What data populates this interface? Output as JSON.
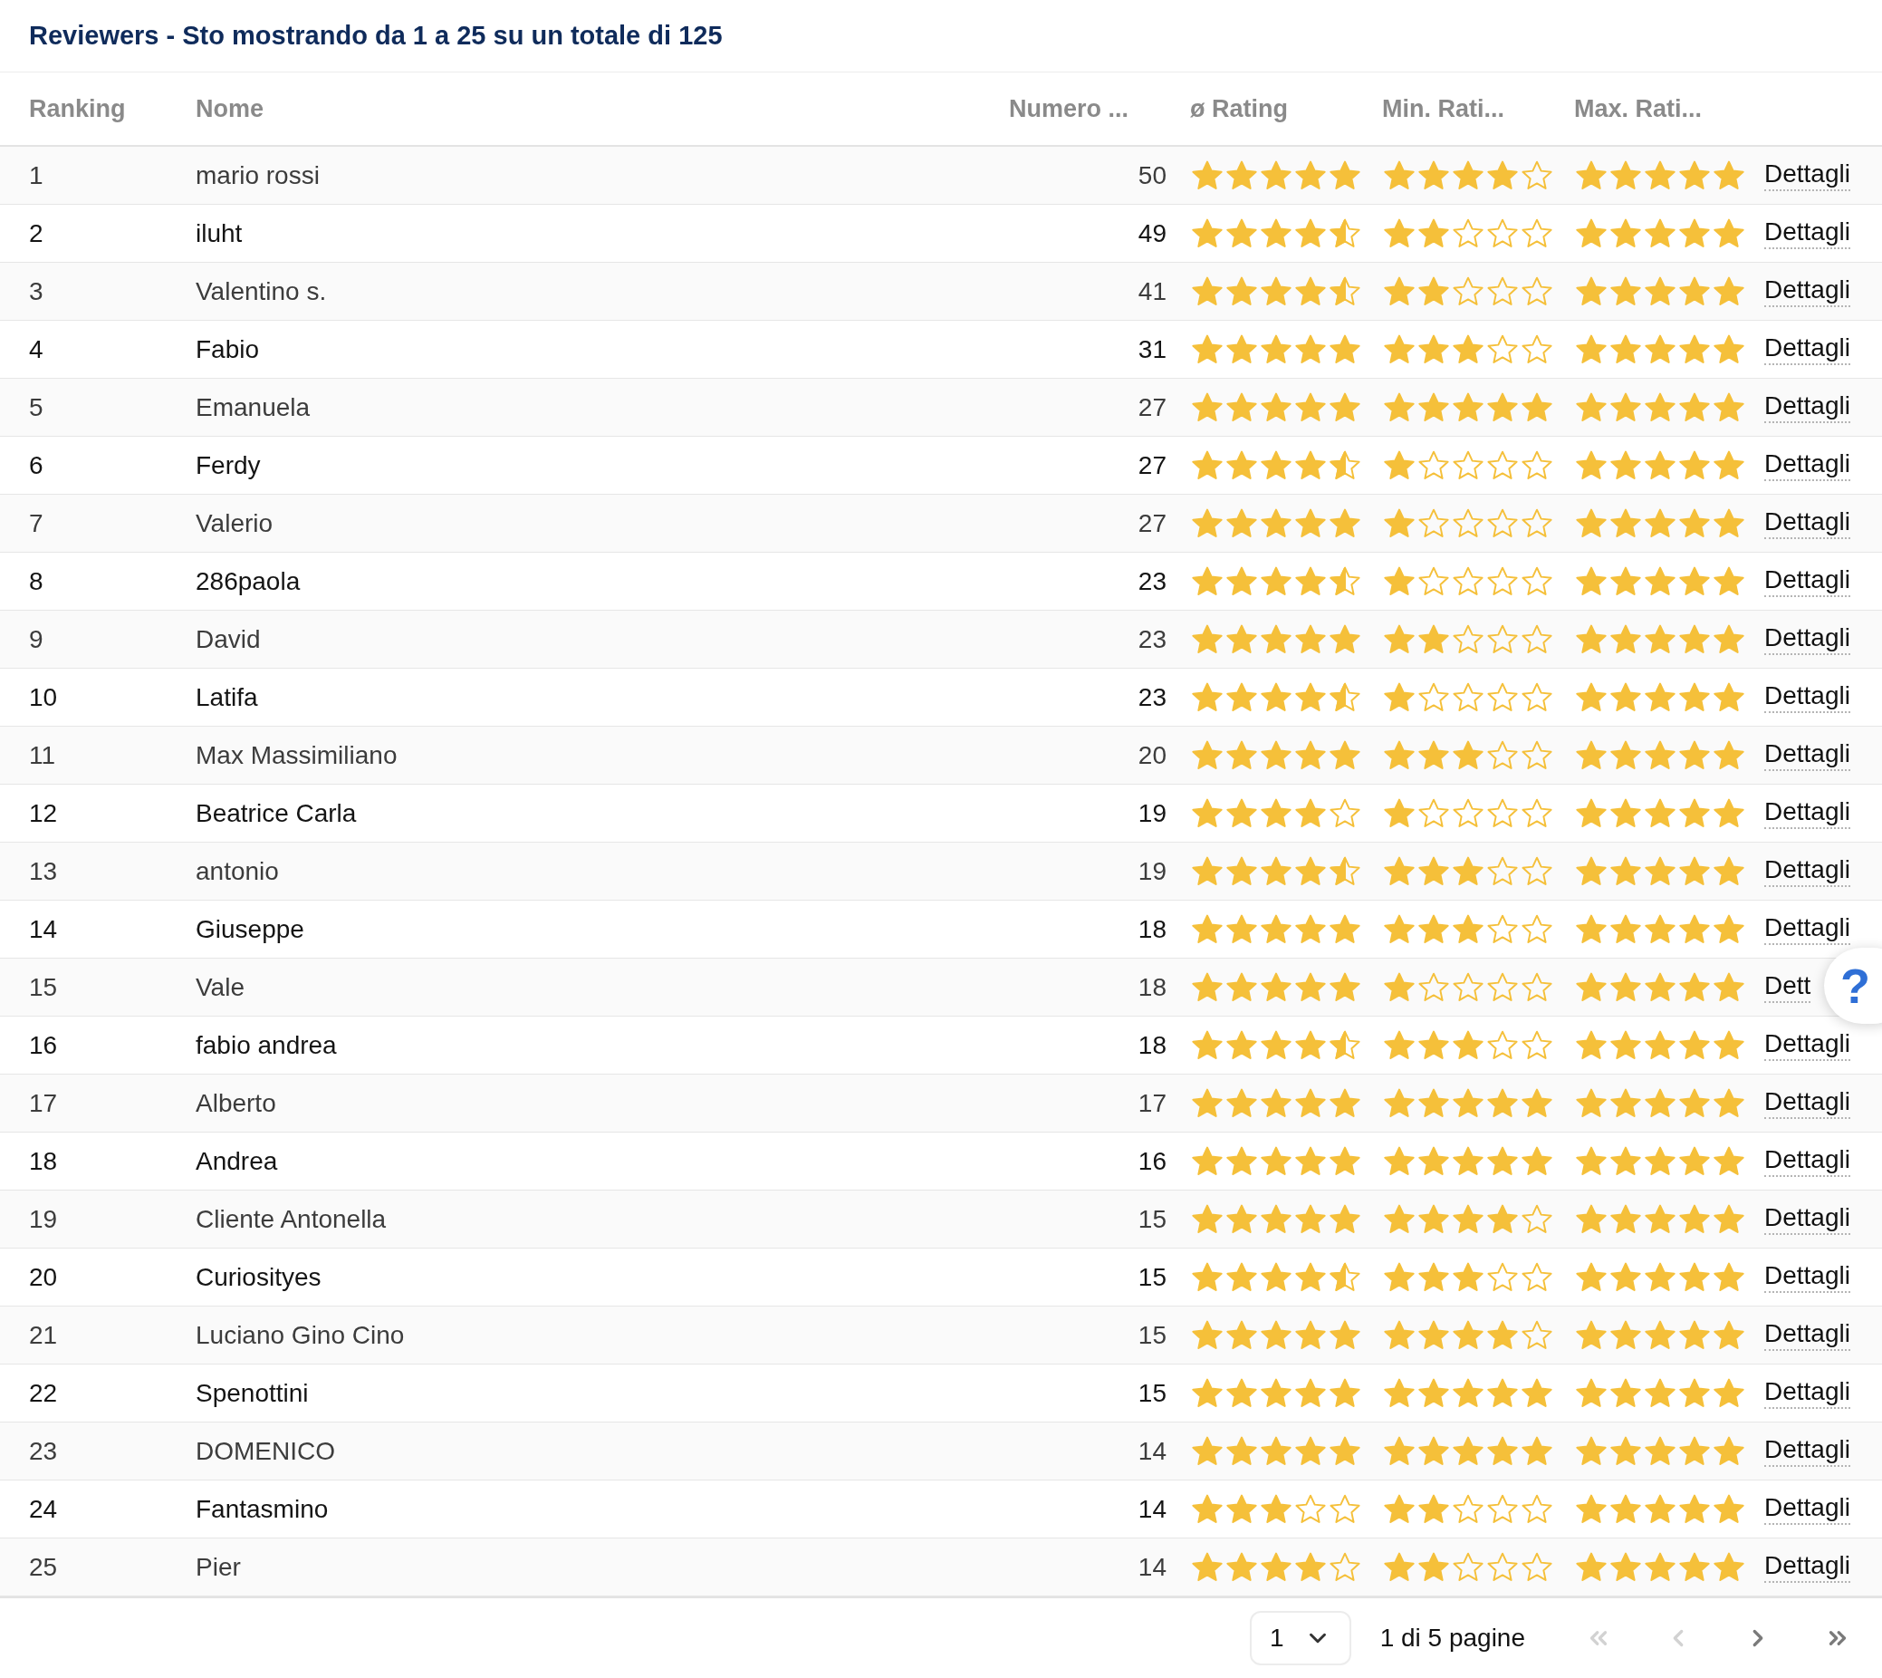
{
  "title": "Reviewers - Sto mostrando da 1 a 25 su un totale di 125",
  "columns": [
    "Ranking",
    "Nome",
    "Numero ...",
    "ø Rating",
    "Min. Rati...",
    "Max. Rati..."
  ],
  "rows": [
    {
      "rank": "1",
      "name": "mario rossi",
      "count": "50",
      "ratings": [
        {
          "stars": 5
        },
        {
          "stars": 4
        },
        {
          "stars": 5
        }
      ],
      "link": "Dettagli"
    },
    {
      "rank": "2",
      "name": "iluht",
      "count": "49",
      "ratings": [
        {
          "stars": 4.5
        },
        {
          "stars": 2
        },
        {
          "stars": 5
        }
      ],
      "link": "Dettagli"
    },
    {
      "rank": "3",
      "name": "Valentino s.",
      "count": "41",
      "ratings": [
        {
          "stars": 4.5
        },
        {
          "stars": 2
        },
        {
          "stars": 5
        }
      ],
      "link": "Dettagli"
    },
    {
      "rank": "4",
      "name": "Fabio",
      "count": "31",
      "ratings": [
        {
          "stars": 5
        },
        {
          "stars": 3
        },
        {
          "stars": 5
        }
      ],
      "link": "Dettagli"
    },
    {
      "rank": "5",
      "name": "Emanuela",
      "count": "27",
      "ratings": [
        {
          "stars": 5
        },
        {
          "stars": 5
        },
        {
          "stars": 5
        }
      ],
      "link": "Dettagli"
    },
    {
      "rank": "6",
      "name": "Ferdy",
      "count": "27",
      "ratings": [
        {
          "stars": 4.5
        },
        {
          "stars": 1
        },
        {
          "stars": 5
        }
      ],
      "link": "Dettagli"
    },
    {
      "rank": "7",
      "name": "Valerio",
      "count": "27",
      "ratings": [
        {
          "stars": 5
        },
        {
          "stars": 1
        },
        {
          "stars": 5
        }
      ],
      "link": "Dettagli"
    },
    {
      "rank": "8",
      "name": "286paola",
      "count": "23",
      "ratings": [
        {
          "stars": 4.5
        },
        {
          "stars": 1
        },
        {
          "stars": 5
        }
      ],
      "link": "Dettagli"
    },
    {
      "rank": "9",
      "name": "David",
      "count": "23",
      "ratings": [
        {
          "stars": 5
        },
        {
          "stars": 2
        },
        {
          "stars": 5
        }
      ],
      "link": "Dettagli"
    },
    {
      "rank": "10",
      "name": "Latifa",
      "count": "23",
      "ratings": [
        {
          "stars": 4.5
        },
        {
          "stars": 1
        },
        {
          "stars": 5
        }
      ],
      "link": "Dettagli"
    },
    {
      "rank": "11",
      "name": "Max Massimiliano",
      "count": "20",
      "ratings": [
        {
          "stars": 5
        },
        {
          "stars": 3
        },
        {
          "stars": 5
        }
      ],
      "link": "Dettagli"
    },
    {
      "rank": "12",
      "name": "Beatrice Carla",
      "count": "19",
      "ratings": [
        {
          "stars": 4
        },
        {
          "stars": 1
        },
        {
          "stars": 5
        }
      ],
      "link": "Dettagli"
    },
    {
      "rank": "13",
      "name": "antonio",
      "count": "19",
      "ratings": [
        {
          "stars": 4.5
        },
        {
          "stars": 3
        },
        {
          "stars": 5
        }
      ],
      "link": "Dettagli"
    },
    {
      "rank": "14",
      "name": "Giuseppe",
      "count": "18",
      "ratings": [
        {
          "stars": 5
        },
        {
          "stars": 3
        },
        {
          "stars": 5
        }
      ],
      "link": "Dettagli"
    },
    {
      "rank": "15",
      "name": "Vale",
      "count": "18",
      "ratings": [
        {
          "stars": 5
        },
        {
          "stars": 1
        },
        {
          "stars": 5
        }
      ],
      "link": "Dett"
    },
    {
      "rank": "16",
      "name": "fabio andrea",
      "count": "18",
      "ratings": [
        {
          "stars": 4.5
        },
        {
          "stars": 3
        },
        {
          "stars": 5
        }
      ],
      "link": "Dettagli"
    },
    {
      "rank": "17",
      "name": "Alberto",
      "count": "17",
      "ratings": [
        {
          "stars": 5
        },
        {
          "stars": 5
        },
        {
          "stars": 5
        }
      ],
      "link": "Dettagli"
    },
    {
      "rank": "18",
      "name": "Andrea",
      "count": "16",
      "ratings": [
        {
          "stars": 5
        },
        {
          "stars": 5
        },
        {
          "stars": 5
        }
      ],
      "link": "Dettagli"
    },
    {
      "rank": "19",
      "name": "Cliente Antonella",
      "count": "15",
      "ratings": [
        {
          "stars": 5
        },
        {
          "stars": 4
        },
        {
          "stars": 5
        }
      ],
      "link": "Dettagli"
    },
    {
      "rank": "20",
      "name": "Curiosityes",
      "count": "15",
      "ratings": [
        {
          "stars": 4.5
        },
        {
          "stars": 3
        },
        {
          "stars": 5
        }
      ],
      "link": "Dettagli"
    },
    {
      "rank": "21",
      "name": "Luciano Gino Cino",
      "count": "15",
      "ratings": [
        {
          "stars": 5
        },
        {
          "stars": 4
        },
        {
          "stars": 5
        }
      ],
      "link": "Dettagli"
    },
    {
      "rank": "22",
      "name": "Spenottini",
      "count": "15",
      "ratings": [
        {
          "stars": 5
        },
        {
          "stars": 5
        },
        {
          "stars": 5
        }
      ],
      "link": "Dettagli"
    },
    {
      "rank": "23",
      "name": "DOMENICO",
      "count": "14",
      "ratings": [
        {
          "stars": 5
        },
        {
          "stars": 5
        },
        {
          "stars": 5
        }
      ],
      "link": "Dettagli"
    },
    {
      "rank": "24",
      "name": "Fantasmino",
      "count": "14",
      "ratings": [
        {
          "stars": 3
        },
        {
          "stars": 2
        },
        {
          "stars": 5
        }
      ],
      "link": "Dettagli"
    },
    {
      "rank": "25",
      "name": "Pier",
      "count": "14",
      "ratings": [
        {
          "stars": 4
        },
        {
          "stars": 2
        },
        {
          "stars": 5
        }
      ],
      "link": "Dettagli"
    }
  ],
  "pagination": {
    "page_select": "1",
    "summary": "1 di 5 pagine",
    "nav": [
      {
        "kind": "first",
        "disabled": true
      },
      {
        "kind": "prev",
        "disabled": true
      },
      {
        "kind": "next",
        "disabled": false
      },
      {
        "kind": "last",
        "disabled": false
      }
    ]
  },
  "help_button": {
    "label": "?"
  }
}
